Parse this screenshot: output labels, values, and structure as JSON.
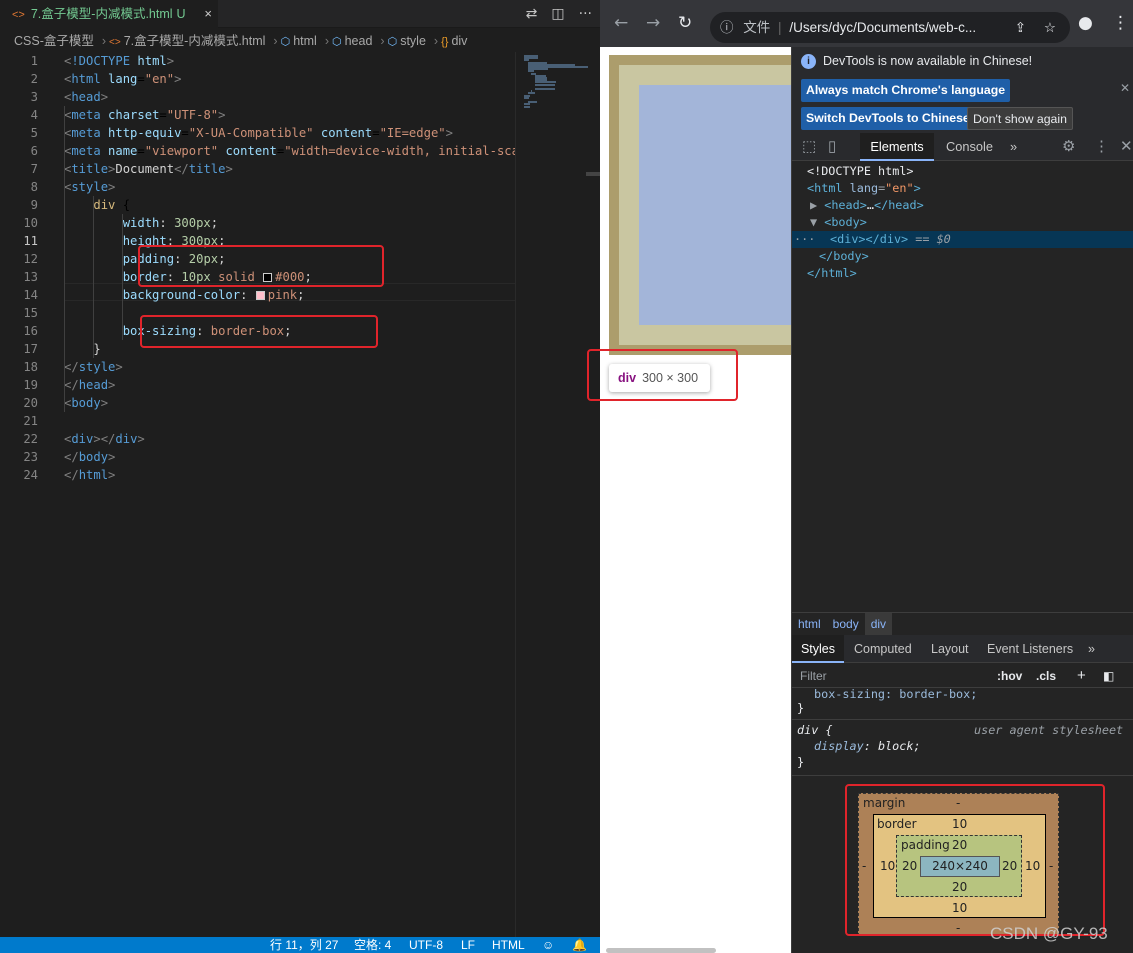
{
  "vscode": {
    "tab": {
      "file_icon": "<>",
      "title": "7.盒子模型-内减模式.html",
      "modified": "U",
      "close": "×"
    },
    "tab_actions": [
      "branch-compare-icon",
      "split-editor-icon",
      "more-icon"
    ],
    "breadcrumb": {
      "folder": "CSS-盒子模型",
      "file": "7.盒子模型-内减模式.html",
      "items": [
        "html",
        "head",
        "style",
        "div"
      ]
    },
    "current_line": 11,
    "code_lines": [
      "<!DOCTYPE html>",
      "<html lang=\"en\">",
      "<head>",
      "    <meta charset=\"UTF-8\">",
      "    <meta http-equiv=\"X-UA-Compatible\" content=\"IE=edge\">",
      "    <meta name=\"viewport\" content=\"width=device-width, initial-scale=1.0\">",
      "    <title>Document</title>",
      "    <style>",
      "        div {",
      "            width: 300px;",
      "            height: 300px;",
      "            padding: 20px;",
      "            border: 10px solid #000;",
      "            background-color: pink;",
      "",
      "            box-sizing: border-box;",
      "        }",
      "    </style>",
      "</head>",
      "<body>",
      "",
      "    <div></div>",
      "</body>",
      "</html>"
    ],
    "status": {
      "position": "行 11，列 27",
      "spaces": "空格: 4",
      "encoding": "UTF-8",
      "eol": "LF",
      "language": "HTML"
    }
  },
  "chrome": {
    "address_prefix": "文件",
    "address": "/Users/dyc/Documents/web-c...",
    "tooltip": {
      "tag": "div",
      "dims": "300 × 300"
    }
  },
  "devtools": {
    "info": "DevTools is now available in Chinese!",
    "btn_match": "Always match Chrome's language",
    "btn_switch": "Switch DevTools to Chinese",
    "btn_dont": "Don't show again",
    "tabs": {
      "elements": "Elements",
      "console": "Console",
      "more": "»"
    },
    "dom": {
      "doctype": "<!DOCTYPE html>",
      "html_open": "html",
      "lang_attr": "lang",
      "lang_val": "\"en\"",
      "head_collapsed": "head",
      "ellipsis": "…",
      "body_open": "body",
      "div": "div",
      "selected_suffix": "== $0",
      "body_close": "/body",
      "html_close": "/html"
    },
    "crumbs": [
      "html",
      "body",
      "div"
    ],
    "style_tabs": [
      "Styles",
      "Computed",
      "Layout",
      "Event Listeners",
      "»"
    ],
    "filter": {
      "placeholder": "Filter",
      "hov": ":hov",
      "cls": ".cls"
    },
    "css": {
      "prev_rule": "box-sizing: border-box;",
      "brace_close": "}",
      "ua_selector": "div {",
      "ua_label": "user agent stylesheet",
      "ua_prop": "display",
      "ua_val": "block;"
    },
    "box_model": {
      "margin_label": "margin",
      "margin": "-",
      "border_label": "border",
      "border": "10",
      "padding_label": "padding",
      "padding": "20",
      "content": "240×240"
    }
  },
  "watermark": "CSDN @GY-93"
}
